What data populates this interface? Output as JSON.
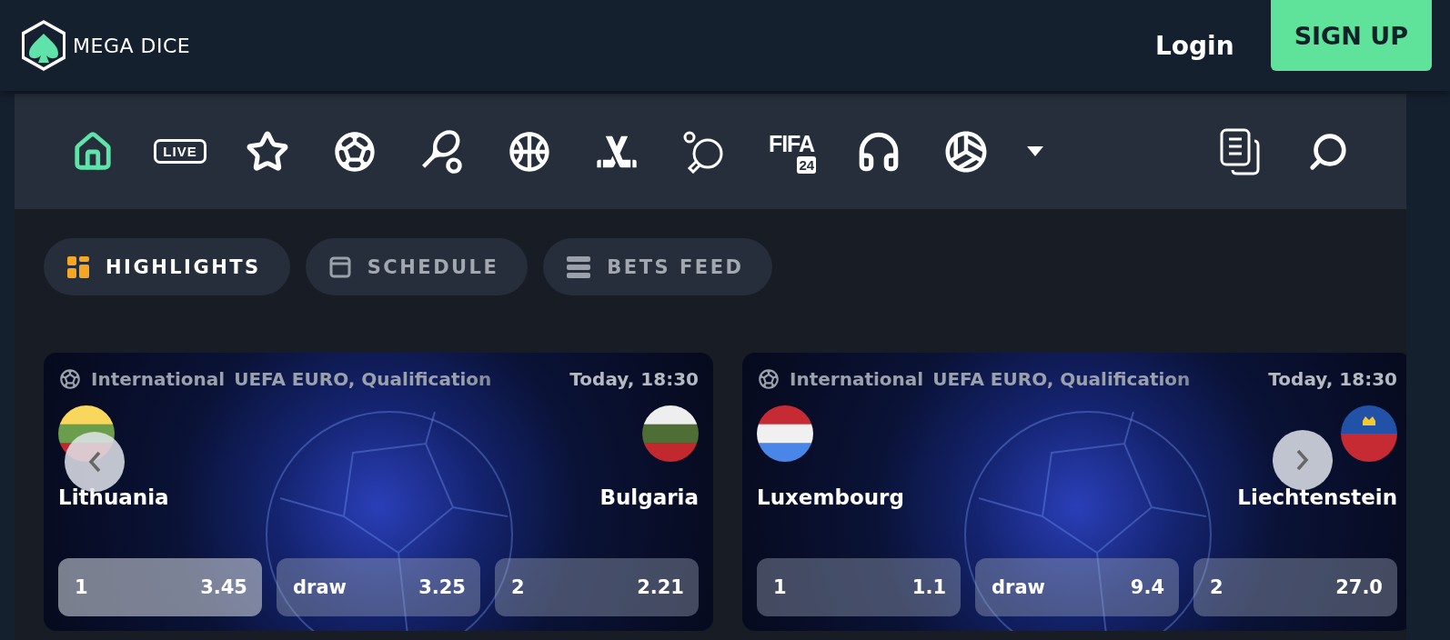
{
  "header": {
    "logo_text": "MEGA DICE",
    "login": "Login",
    "signup": "SIGN UP"
  },
  "sports_nav": {
    "items": [
      {
        "kind": "home",
        "selected": true
      },
      {
        "kind": "live",
        "label": "LIVE",
        "selected": false
      },
      {
        "kind": "favorites",
        "selected": false
      },
      {
        "kind": "soccer",
        "selected": false
      },
      {
        "kind": "tennis",
        "selected": false
      },
      {
        "kind": "basketball",
        "selected": false
      },
      {
        "kind": "hockey",
        "selected": false
      },
      {
        "kind": "table-tennis",
        "selected": false
      },
      {
        "kind": "fifa",
        "label": "FIFA",
        "badge": "24",
        "selected": false
      },
      {
        "kind": "support",
        "selected": false
      },
      {
        "kind": "volleyball",
        "selected": false
      },
      {
        "kind": "more",
        "selected": false
      }
    ],
    "actions": [
      {
        "kind": "betslip"
      },
      {
        "kind": "search"
      }
    ]
  },
  "tabs": [
    {
      "kind": "highlights",
      "label": "HIGHLIGHTS",
      "selected": true
    },
    {
      "kind": "schedule",
      "label": "SCHEDULE",
      "selected": false
    },
    {
      "kind": "feed",
      "label": "BETS FEED",
      "selected": false
    }
  ],
  "matches": [
    {
      "category": "International",
      "league": "UEFA EURO, Qualification",
      "time": "Today, 18:30",
      "home": {
        "name": "Lithuania"
      },
      "away": {
        "name": "Bulgaria"
      },
      "odds": [
        {
          "label": "1",
          "value": "3.45",
          "selected": true
        },
        {
          "label": "draw",
          "value": "3.25",
          "selected": false
        },
        {
          "label": "2",
          "value": "2.21",
          "selected": false
        }
      ]
    },
    {
      "category": "International",
      "league": "UEFA EURO, Qualification",
      "time": "Today, 18:30",
      "home": {
        "name": "Luxembourg"
      },
      "away": {
        "name": "Liechtenstein"
      },
      "odds": [
        {
          "label": "1",
          "value": "1.1",
          "selected": false
        },
        {
          "label": "draw",
          "value": "9.4",
          "selected": false
        },
        {
          "label": "2",
          "value": "27.0",
          "selected": false
        }
      ]
    }
  ]
}
